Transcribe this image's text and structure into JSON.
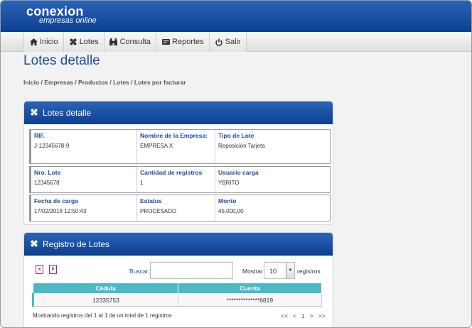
{
  "header": {
    "logo_line1": "conexion",
    "logo_line2": "empresas online"
  },
  "menu": {
    "items": [
      {
        "label": "Inicio",
        "icon": "home-icon"
      },
      {
        "label": "Lotes",
        "icon": "lotes-icon"
      },
      {
        "label": "Consulta",
        "icon": "consulta-icon"
      },
      {
        "label": "Reportes",
        "icon": "reportes-icon"
      },
      {
        "label": "Salir",
        "icon": "power-icon"
      }
    ]
  },
  "page": {
    "title": "Lotes detalle",
    "breadcrumb": "Inicio / Empresas / Productos / Lotes / Lotes por facturar"
  },
  "detail_panel": {
    "title": "Lotes detalle",
    "rows": [
      [
        {
          "label": "RIF.",
          "value": "J-12345678-9"
        },
        {
          "label": "Nombre de la Empresa:",
          "value": "EMPRESA X"
        },
        {
          "label": "Tipo de Lote",
          "value": "Reposición Tarjeta"
        }
      ],
      [
        {
          "label": "Nro. Lote",
          "value": "12345678"
        },
        {
          "label": "Cantidad de registros",
          "value": "1"
        },
        {
          "label": "Usuario carga",
          "value": "YBRITO"
        }
      ],
      [
        {
          "label": "Fecha de carga",
          "value": "17/02/2018 12:50:43"
        },
        {
          "label": "Estatus",
          "value": "PROCESADO"
        },
        {
          "label": "Monto",
          "value": "45.000,00"
        }
      ]
    ]
  },
  "registry_panel": {
    "title": "Registro de Lotes",
    "search_label": "Buscar:",
    "search_value": "",
    "show_label": "Mostrar",
    "show_value": "10",
    "records_label": "registros",
    "columns": [
      "Cédula",
      "Cuenta"
    ],
    "rows": [
      [
        "12335753",
        "**************8819"
      ]
    ],
    "info": "Mostrando registros del 1 al 1 de un total de 1 registros",
    "pager": {
      "first": "<<",
      "prev": "<",
      "page": "1",
      "next": ">",
      "last": ">>"
    }
  },
  "colors": {
    "brand_blue": "#0d3f8e",
    "table_header": "#4bb8c8"
  }
}
